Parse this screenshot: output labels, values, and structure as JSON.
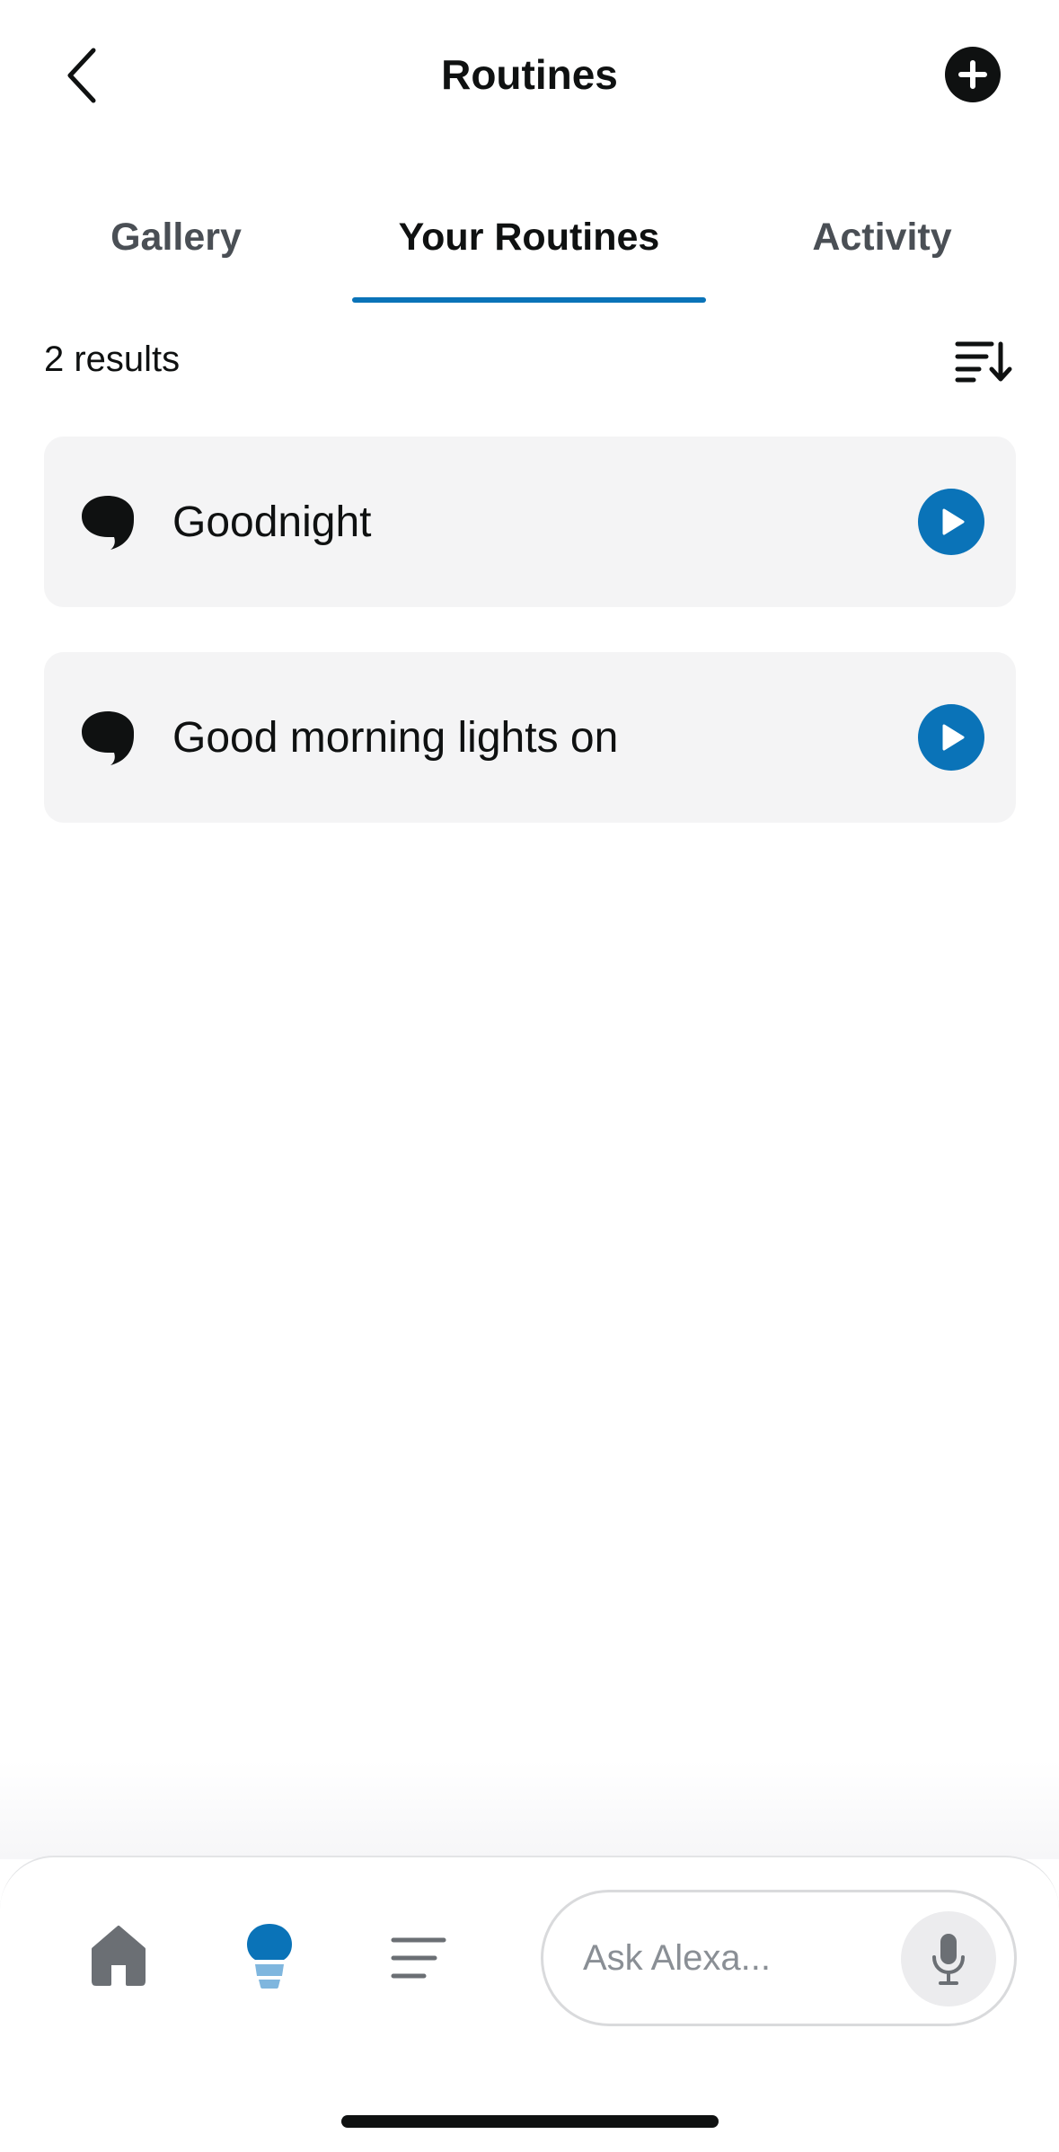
{
  "header": {
    "title": "Routines"
  },
  "tabs": [
    {
      "label": "Gallery",
      "active": false
    },
    {
      "label": "Your Routines",
      "active": true
    },
    {
      "label": "Activity",
      "active": false
    }
  ],
  "results": {
    "count_label": "2 results"
  },
  "routines": [
    {
      "name": "Goodnight"
    },
    {
      "name": "Good morning lights on"
    }
  ],
  "bottom_nav": {
    "ask_placeholder": "Ask Alexa..."
  },
  "colors": {
    "accent": "#0a73b8",
    "card_bg": "#f4f4f5",
    "text": "#0f1111"
  },
  "icons": {
    "back": "chevron-left-icon",
    "add": "plus-circle-icon",
    "sort": "sort-icon",
    "routine": "speech-bubble-icon",
    "play": "play-icon",
    "home": "home-icon",
    "routines_nav": "lightbulb-icon",
    "more": "menu-lines-icon",
    "mic": "microphone-icon"
  }
}
